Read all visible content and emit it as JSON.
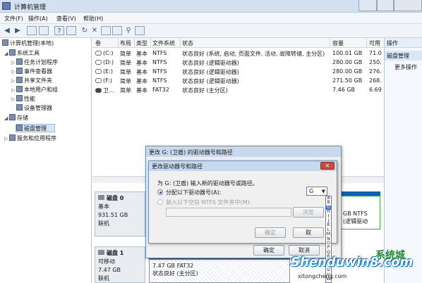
{
  "window": {
    "title": "计算机管理"
  },
  "menu": [
    "文件(F)",
    "操作(A)",
    "查看(V)",
    "帮助(H)"
  ],
  "toolbar_icons": [
    "back-icon",
    "forward-icon",
    "up-folder-icon",
    "show-hide-tree-icon",
    "help-icon",
    "properties-icon",
    "refresh-icon",
    "delete-icon",
    "new-icon",
    "open-icon",
    "search-icon",
    "settings-icon"
  ],
  "tree": {
    "root": "计算机管理(本地)",
    "items": [
      {
        "label": "系统工具",
        "level": 1
      },
      {
        "label": "任务计划程序",
        "level": 2
      },
      {
        "label": "事件查看器",
        "level": 2
      },
      {
        "label": "共享文件夹",
        "level": 2
      },
      {
        "label": "本地用户和组",
        "level": 2
      },
      {
        "label": "性能",
        "level": 2
      },
      {
        "label": "设备管理器",
        "level": 2
      },
      {
        "label": "存储",
        "level": 1
      },
      {
        "label": "磁盘管理",
        "level": 2,
        "selected": true
      },
      {
        "label": "服务和应用程序",
        "level": 1
      }
    ]
  },
  "volumes": {
    "columns": [
      "卷",
      "布局",
      "类型",
      "文件系统",
      "状态",
      "容量",
      "可用"
    ],
    "rows": [
      [
        "(C:)",
        "简单",
        "基本",
        "NTFS",
        "状态良好 (系统, 启动, 页面文件, 活动, 故障转储, 主分区)",
        "100.01 GB",
        "71.0"
      ],
      [
        "(D:)",
        "简单",
        "基本",
        "NTFS",
        "状态良好 (逻辑驱动器)",
        "280.00 GB",
        "250."
      ],
      [
        "(E:)",
        "简单",
        "基本",
        "NTFS",
        "状态良好 (逻辑驱动器)",
        "280.00 GB",
        "276."
      ],
      [
        "(F:)",
        "简单",
        "基本",
        "NTFS",
        "状态良好 (逻辑驱动器)",
        "271.50 GB",
        "268."
      ],
      [
        "卫...",
        "简单",
        "基本",
        "FAT32",
        "状态良好 (主分区)",
        "7.46 GB",
        "6.69"
      ]
    ]
  },
  "disks": [
    {
      "name": "磁盘 0",
      "type": "基本",
      "size": "931.51 GB",
      "status": "联机",
      "right_partition": {
        "size": "GB NTFS",
        "status": "(逻辑驱动"
      }
    },
    {
      "name": "磁盘 1",
      "type": "可移动",
      "size": "7.47 GB",
      "status": "联机",
      "partition": {
        "size": "7.47 GB FAT32",
        "status": "状态良好 (主分区)"
      }
    }
  ],
  "actions": {
    "header": "操作",
    "section": "磁盘管理",
    "more": "更多操作"
  },
  "outer_dialog": {
    "title": "更改 G: (卫盾) 的驱动器号和路径",
    "ok": "确定",
    "cancel": "取消"
  },
  "inner_dialog": {
    "title": "更改驱动器号和路径",
    "prompt": "为 G: (卫盾) 输入新的驱动器号或路径。",
    "option_assign": "分配以下驱动器号(A):",
    "option_mount": "装入以下空白 NTFS 文件夹中(M):",
    "browse": "浏览",
    "ok": "确定",
    "cancel": "取"
  },
  "drive_select": {
    "value": "G",
    "options": [
      "A",
      "B",
      "G",
      "H",
      "I",
      "J",
      "K",
      "L",
      "M",
      "N",
      "O",
      "P",
      "Q",
      "R",
      "S",
      "T",
      "U",
      "V",
      "W"
    ],
    "highlighted": "G"
  },
  "watermark": {
    "text": "Shenduwin8.com",
    "sub": "xitongcheng.com",
    "logo": "系统城"
  }
}
